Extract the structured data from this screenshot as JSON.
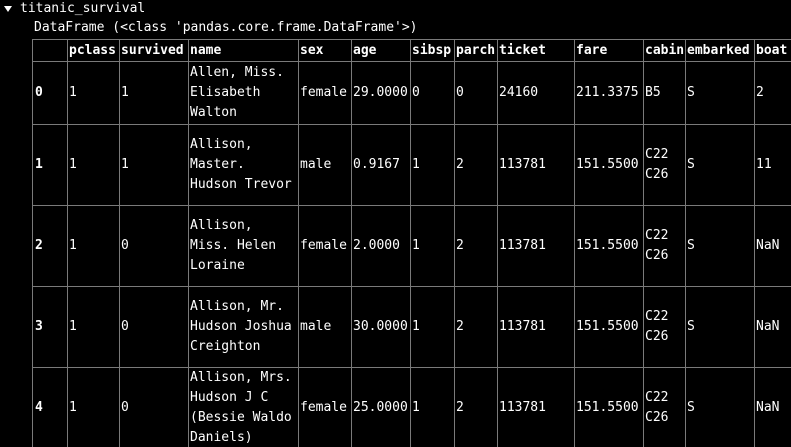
{
  "variable": {
    "name": "titanic_survival",
    "type_line": "DataFrame (<class 'pandas.core.frame.DataFrame'>)"
  },
  "table": {
    "columns": [
      "",
      "pclass",
      "survived",
      "name",
      "sex",
      "age",
      "sibsp",
      "parch",
      "ticket",
      "fare",
      "cabin",
      "embarked",
      "boat"
    ],
    "rows": [
      {
        "index": "0",
        "pclass": "1",
        "survived": "1",
        "name": [
          "Allen, Miss.",
          "Elisabeth",
          "Walton"
        ],
        "sex": "female",
        "age": "29.0000",
        "sibsp": "0",
        "parch": "0",
        "ticket": "24160",
        "fare": "211.3375",
        "cabin": [
          "B5"
        ],
        "embarked": "S",
        "boat": "2"
      },
      {
        "index": "1",
        "pclass": "1",
        "survived": "1",
        "name": [
          "Allison,",
          "Master.",
          "Hudson Trevor"
        ],
        "sex": "male",
        "age": "0.9167",
        "sibsp": "1",
        "parch": "2",
        "ticket": "113781",
        "fare": "151.5500",
        "cabin": [
          "C22",
          "C26"
        ],
        "embarked": "S",
        "boat": "11"
      },
      {
        "index": "2",
        "pclass": "1",
        "survived": "0",
        "name": [
          "Allison,",
          "Miss. Helen",
          "Loraine"
        ],
        "sex": "female",
        "age": "2.0000",
        "sibsp": "1",
        "parch": "2",
        "ticket": "113781",
        "fare": "151.5500",
        "cabin": [
          "C22",
          "C26"
        ],
        "embarked": "S",
        "boat": "NaN"
      },
      {
        "index": "3",
        "pclass": "1",
        "survived": "0",
        "name": [
          "Allison, Mr.",
          "Hudson Joshua",
          "Creighton"
        ],
        "sex": "male",
        "age": "30.0000",
        "sibsp": "1",
        "parch": "2",
        "ticket": "113781",
        "fare": "151.5500",
        "cabin": [
          "C22",
          "C26"
        ],
        "embarked": "S",
        "boat": "NaN"
      },
      {
        "index": "4",
        "pclass": "1",
        "survived": "0",
        "name": [
          "Allison, Mrs.",
          "Hudson J C",
          "(Bessie Waldo",
          "Daniels)"
        ],
        "sex": "female",
        "age": "25.0000",
        "sibsp": "1",
        "parch": "2",
        "ticket": "113781",
        "fare": "151.5500",
        "cabin": [
          "C22",
          "C26"
        ],
        "embarked": "S",
        "boat": "NaN"
      }
    ]
  },
  "icons": {
    "expand_toggle": "triangle-down-icon"
  },
  "colors": {
    "background": "#000000",
    "text": "#ffffff",
    "grid": "#7a7a7a"
  }
}
